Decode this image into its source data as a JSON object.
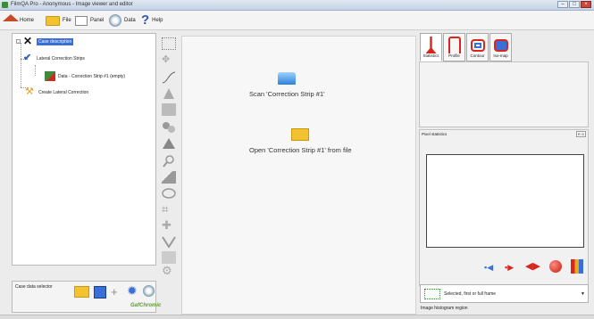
{
  "window": {
    "title": "FilmQA Pro - Anonymous - Image viewer and editor"
  },
  "menubar": {
    "home_label": "Home",
    "file_label": "File",
    "panel_label": "Panel",
    "data_label": "Data",
    "help_label": "Help"
  },
  "tree": {
    "items": [
      {
        "label": "Case description"
      },
      {
        "label": "Lateral Correction Strips"
      },
      {
        "label": "Data - Correction Strip #1 (empty)"
      },
      {
        "label": "Create Lateral Correction"
      }
    ]
  },
  "selector": {
    "label": "Case data selector",
    "brand": "GafChromic"
  },
  "center": {
    "scan_label": "Scan 'Correction Strip #1'",
    "open_label": "Open 'Correction Strip #1' from file"
  },
  "right": {
    "tabs": [
      {
        "label": "Statistics"
      },
      {
        "label": "Profile"
      },
      {
        "label": "Contour"
      },
      {
        "label": "Iso-map"
      }
    ],
    "pixel_stats_label": "Pixel statistics",
    "pixel_stats_btn": "R G",
    "dropdown_value": "Selected, first or full frame",
    "histogram_label": "Image histogram region"
  },
  "colors": {
    "accent": "#3a6fd8",
    "brand_green": "#3c8a3c",
    "danger": "#d9261c"
  }
}
